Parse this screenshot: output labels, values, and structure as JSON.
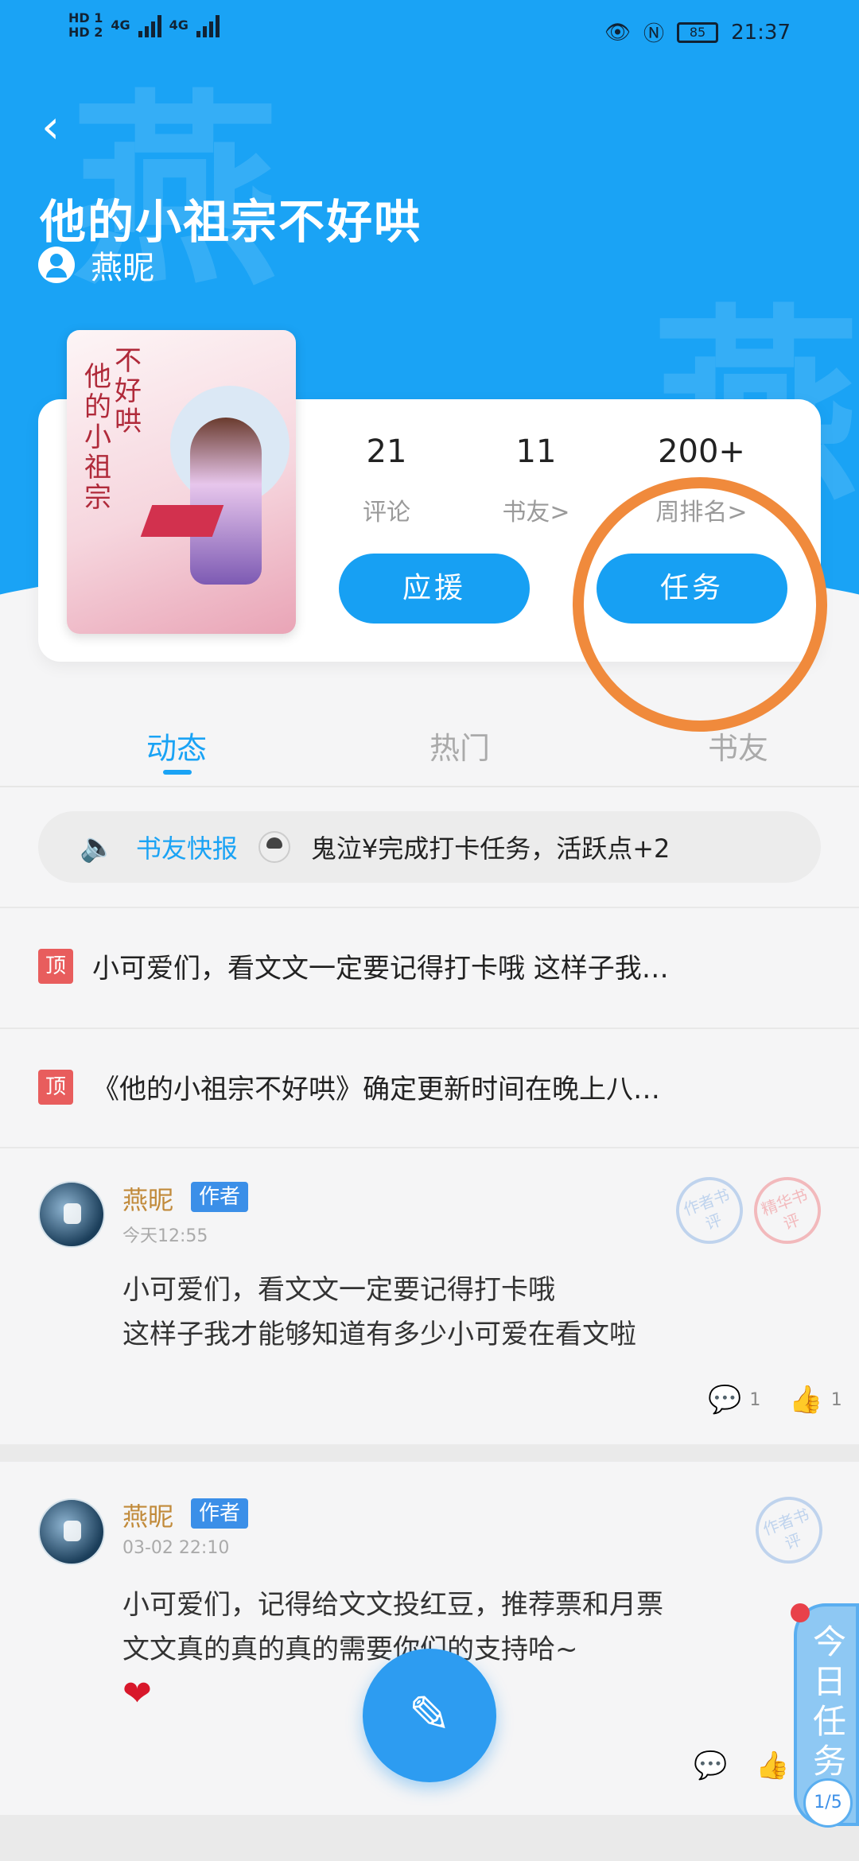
{
  "status_bar": {
    "hd1": "HD 1",
    "hd2": "HD 2",
    "net1": "4G",
    "net2": "4G",
    "battery": "85",
    "time": "21:37"
  },
  "header": {
    "back_icon": "chevron-left-icon",
    "title": "他的小祖宗不好哄",
    "author": "燕昵",
    "watermark": "燕"
  },
  "book": {
    "cover_title_col1": "不好哄",
    "cover_title_col2": "他的小祖宗",
    "stats": [
      {
        "value": "21",
        "label": "评论"
      },
      {
        "value": "11",
        "label": "书友>"
      },
      {
        "value": "200+",
        "label": "周排名>"
      }
    ],
    "support_button": "应援",
    "task_button": "任务"
  },
  "tabs": [
    {
      "label": "动态",
      "active": true
    },
    {
      "label": "热门",
      "active": false
    },
    {
      "label": "书友",
      "active": false
    }
  ],
  "news_bar": {
    "label": "书友快报",
    "text": "鬼泣¥完成打卡任务，活跃点+2"
  },
  "pinned": [
    {
      "badge": "顶",
      "text": "小可爱们，看文文一定要记得打卡哦 这样子我…"
    },
    {
      "badge": "顶",
      "text": "《他的小祖宗不好哄》确定更新时间在晚上八…"
    }
  ],
  "posts": [
    {
      "name": "燕昵",
      "tag": "作者",
      "time": "今天12:55",
      "stamps": [
        "作者书评",
        "精华书评"
      ],
      "lines": [
        "小可爱们，看文文一定要记得打卡哦",
        "这样子我才能够知道有多少小可爱在看文啦"
      ],
      "comments": "1",
      "likes": "1"
    },
    {
      "name": "燕昵",
      "tag": "作者",
      "time": "03-02 22:10",
      "stamps": [
        "作者书评"
      ],
      "lines": [
        "小可爱们，记得给文文投红豆，推荐票和月票",
        "文文真的真的真的需要你们的支持哈~"
      ]
    }
  ],
  "task_widget": {
    "label": "今日任务",
    "progress": "1/5"
  },
  "colors": {
    "primary": "#1aa3f5",
    "annotation": "#f08a3c",
    "pin": "#e85d5d"
  }
}
